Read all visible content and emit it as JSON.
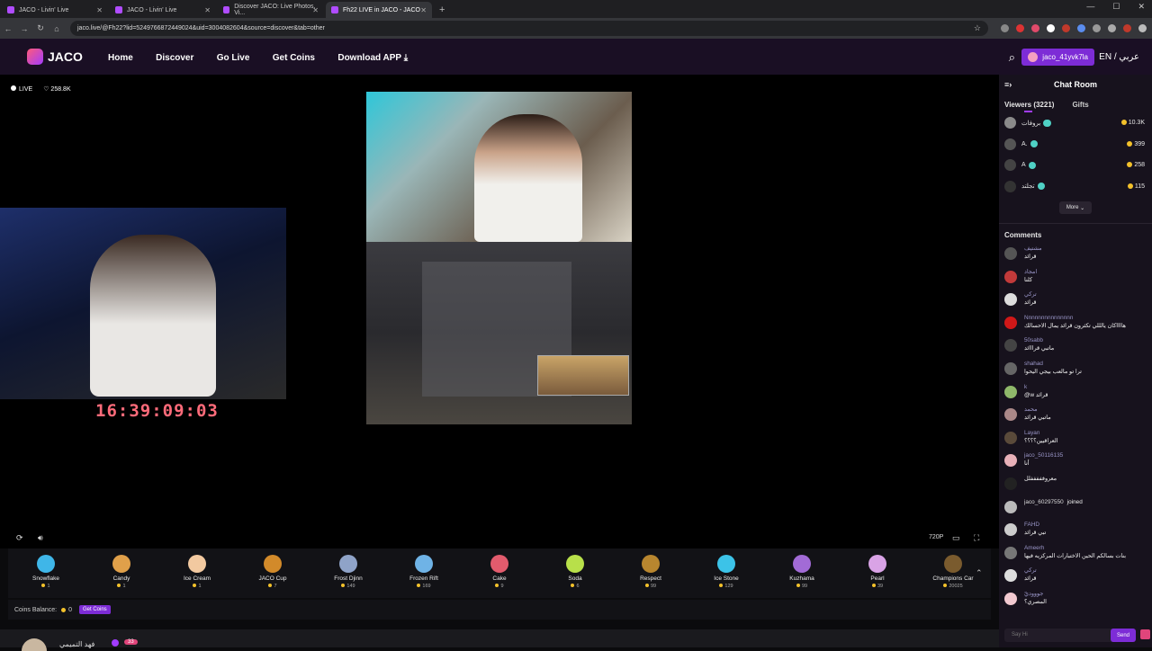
{
  "browser": {
    "tabs": [
      {
        "label": "JACO - Livin' Live"
      },
      {
        "label": "JACO - Livin' Live"
      },
      {
        "label": "Discover JACO: Live Photos, Vi..."
      },
      {
        "label": "Fh22 LIVE in JACO - JACO"
      }
    ],
    "url": "jaco.live/@Fh22?lid=5249766872449024&uid=3004082604&source=discover&tab=other"
  },
  "site": {
    "logo": "JACO",
    "nav": [
      "Home",
      "Discover",
      "Go Live",
      "Get Coins",
      "Download APP"
    ],
    "username": "jaco_41yvk7la",
    "language": "EN / عربي"
  },
  "stream": {
    "live_label": "LIVE",
    "likes": "258.8K",
    "timer": "16:39:09:03",
    "quality": "720P"
  },
  "gifts": [
    {
      "name": "Snowflake",
      "price": "1",
      "color": "#3fb6e8"
    },
    {
      "name": "Candy",
      "price": "1",
      "color": "#e0a04a"
    },
    {
      "name": "Ice Cream",
      "price": "1",
      "color": "#f2c9a0"
    },
    {
      "name": "JACO Cup",
      "price": "7",
      "color": "#d28a2a"
    },
    {
      "name": "Frost Djinn",
      "price": "149",
      "color": "#8fa3c8"
    },
    {
      "name": "Frozen Rift",
      "price": "169",
      "color": "#6fb3e6"
    },
    {
      "name": "Cake",
      "price": "9",
      "color": "#e25b6d"
    },
    {
      "name": "Soda",
      "price": "6",
      "color": "#b8e04a"
    },
    {
      "name": "Respect",
      "price": "99",
      "color": "#b8862f"
    },
    {
      "name": "Ice Stone",
      "price": "129",
      "color": "#3cc3e8"
    },
    {
      "name": "Kuzhama",
      "price": "99",
      "color": "#a26bd6"
    },
    {
      "name": "Pearl",
      "price": "39",
      "color": "#d9a3e6"
    },
    {
      "name": "Champions Car",
      "price": "20025",
      "color": "#7a5b2e"
    }
  ],
  "balance": {
    "label": "Coins Balance:",
    "value": "0",
    "button": "Get Coins"
  },
  "streamer_bar": {
    "name": "فهد التميمي",
    "level": "33"
  },
  "chat": {
    "title": "Chat Room",
    "viewers_tab": "Viewers (3221)",
    "gifts_tab": "Gifts",
    "viewers": [
      {
        "name": "بروفات",
        "level": "",
        "coins": "10.3K",
        "color": "#8a8a8a"
      },
      {
        "name": "A.",
        "level": "",
        "coins": "399",
        "color": "#555"
      },
      {
        "name": "A",
        "level": "",
        "coins": "258",
        "color": "#444"
      },
      {
        "name": "تجلتد",
        "level": "",
        "coins": "115",
        "color": "#333"
      }
    ],
    "more": "More",
    "comments_title": "Comments",
    "comments": [
      {
        "user": "مشتيف",
        "text": "قرائد",
        "color": "#555"
      },
      {
        "user": "امجاد",
        "text": "كلنا",
        "color": "#c23a3a"
      },
      {
        "user": "تركي",
        "text": "قرائد",
        "color": "#ddd"
      },
      {
        "user": "Nnnnnnnnnnnnnnn",
        "text": "هااااكان يالللي تكثرون قرائد يمال الاحسالك",
        "color": "#d01818"
      },
      {
        "user": "50sabb",
        "text": "ماتبي قرااائد",
        "color": "#444"
      },
      {
        "user": "shahad",
        "text": "ترا تو مالعب بيجي اليحوا",
        "color": "#666"
      },
      {
        "user": "k",
        "text": "@w قرائد",
        "color": "#8fb86a"
      },
      {
        "user": "محمد",
        "text": "ماتبي قرائد",
        "color": "#a88"
      },
      {
        "user": "Layan",
        "text": "العراقيين؟؟؟؟",
        "color": "#5a4a3a"
      },
      {
        "user": "jaco_50116135",
        "text": "أنا",
        "color": "#e8b0b8"
      },
      {
        "user": "",
        "text": "معروفففففلل",
        "color": "#222"
      },
      {
        "user": "jaco_60297550",
        "text": "joined",
        "color": "#bbb"
      },
      {
        "user": "FAHD",
        "text": "تبي قرائد",
        "color": "#ccc"
      },
      {
        "user": "Ameerh",
        "text": "بنات بسالكم الحين الاختبارات المركزيه فيها",
        "color": "#777"
      },
      {
        "user": "تركي",
        "text": "قرائد",
        "color": "#ddd"
      },
      {
        "user": "جوووديّ",
        "text": "المصري؟",
        "color": "#f2c9d0"
      }
    ],
    "input_placeholder": "Say Hi",
    "send": "Send"
  }
}
